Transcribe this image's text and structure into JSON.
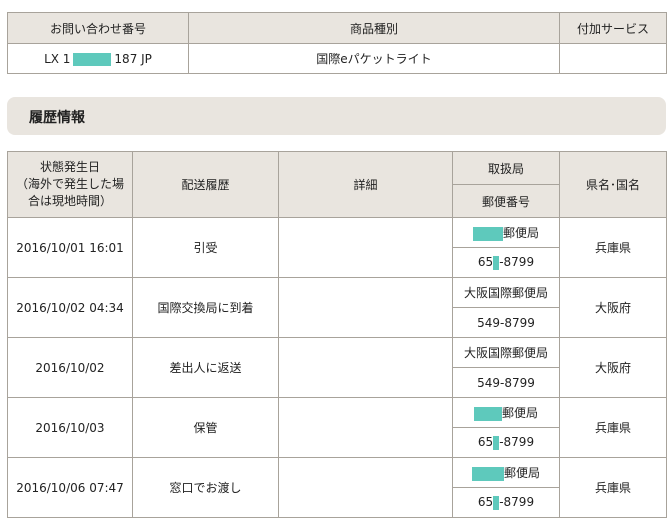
{
  "top_table": {
    "headers": [
      "お問い合わせ番号",
      "商品種別",
      "付加サービス"
    ],
    "tracking_prefix": "LX 1",
    "tracking_suffix": "187 JP",
    "product_type": "国際eパケットライト",
    "additional_service": ""
  },
  "history": {
    "section_title": "履歴情報",
    "headers": {
      "date_line1": "状態発生日",
      "date_line2": "（海外で発生した場",
      "date_line3": "合は現地時間）",
      "status": "配送履歴",
      "details": "詳細",
      "office": "取扱局",
      "postal": "郵便番号",
      "region": "県名･国名"
    },
    "rows": [
      {
        "date": "2016/10/01 16:01",
        "status": "引受",
        "details": "",
        "office": "郵便局",
        "postal_pre": "65",
        "postal_post": "-8799",
        "region": "兵庫県"
      },
      {
        "date": "2016/10/02 04:34",
        "status": "国際交換局に到着",
        "details": "",
        "office": "大阪国際郵便局",
        "postal_pre": "549-8799",
        "postal_post": "",
        "region": "大阪府"
      },
      {
        "date": "2016/10/02",
        "status": "差出人に返送",
        "details": "",
        "office": "大阪国際郵便局",
        "postal_pre": "549-8799",
        "postal_post": "",
        "region": "大阪府"
      },
      {
        "date": "2016/10/03",
        "status": "保管",
        "details": "",
        "office": "郵便局",
        "postal_pre": "65",
        "postal_post": "-8799",
        "region": "兵庫県"
      },
      {
        "date": "2016/10/06 07:47",
        "status": "窓口でお渡し",
        "details": "",
        "office": "郵便局",
        "postal_pre": "65",
        "postal_post": "-8799",
        "region": "兵庫県"
      }
    ]
  },
  "colors": {
    "header_bg": "#e9e5df",
    "border": "#a8a39b",
    "redaction": "#5ec9bc"
  }
}
